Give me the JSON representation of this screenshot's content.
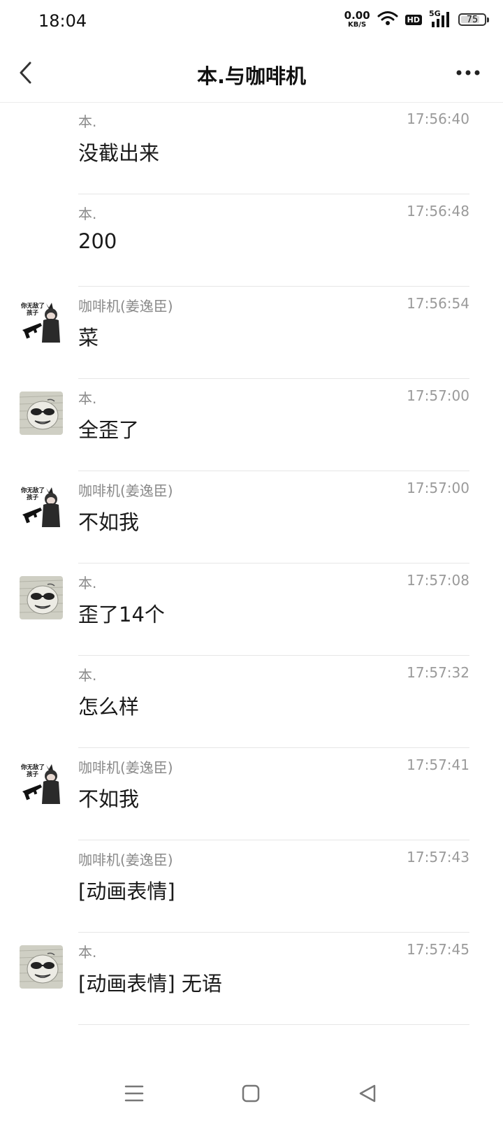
{
  "status_bar": {
    "time": "18:04",
    "net_speed": "0.00",
    "net_unit": "KB/S",
    "hd": "HD",
    "signal_type": "5G",
    "battery": "75"
  },
  "header": {
    "title": "本.与咖啡机"
  },
  "messages": [
    {
      "sender": "本.",
      "time": "17:56:40",
      "text": "没截出来",
      "avatar": "none"
    },
    {
      "sender": "本.",
      "time": "17:56:48",
      "text": "200",
      "avatar": "none"
    },
    {
      "sender": "咖啡机(姜逸臣)",
      "time": "17:56:54",
      "text": "菜",
      "avatar": "gun-girl"
    },
    {
      "sender": "本.",
      "time": "17:57:00",
      "text": "全歪了",
      "avatar": "sunglasses-face"
    },
    {
      "sender": "咖啡机(姜逸臣)",
      "time": "17:57:00",
      "text": "不如我",
      "avatar": "gun-girl"
    },
    {
      "sender": "本.",
      "time": "17:57:08",
      "text": "歪了14个",
      "avatar": "sunglasses-face"
    },
    {
      "sender": "本.",
      "time": "17:57:32",
      "text": "怎么样",
      "avatar": "none"
    },
    {
      "sender": "咖啡机(姜逸臣)",
      "time": "17:57:41",
      "text": "不如我",
      "avatar": "gun-girl"
    },
    {
      "sender": "咖啡机(姜逸臣)",
      "time": "17:57:43",
      "text": "[动画表情]",
      "avatar": "none"
    },
    {
      "sender": "本.",
      "time": "17:57:45",
      "text": "[动画表情] 无语",
      "avatar": "sunglasses-face"
    }
  ],
  "avatar_text": {
    "gun_girl_caption_line1": "你无敌了",
    "gun_girl_caption_line2": "孩子"
  }
}
